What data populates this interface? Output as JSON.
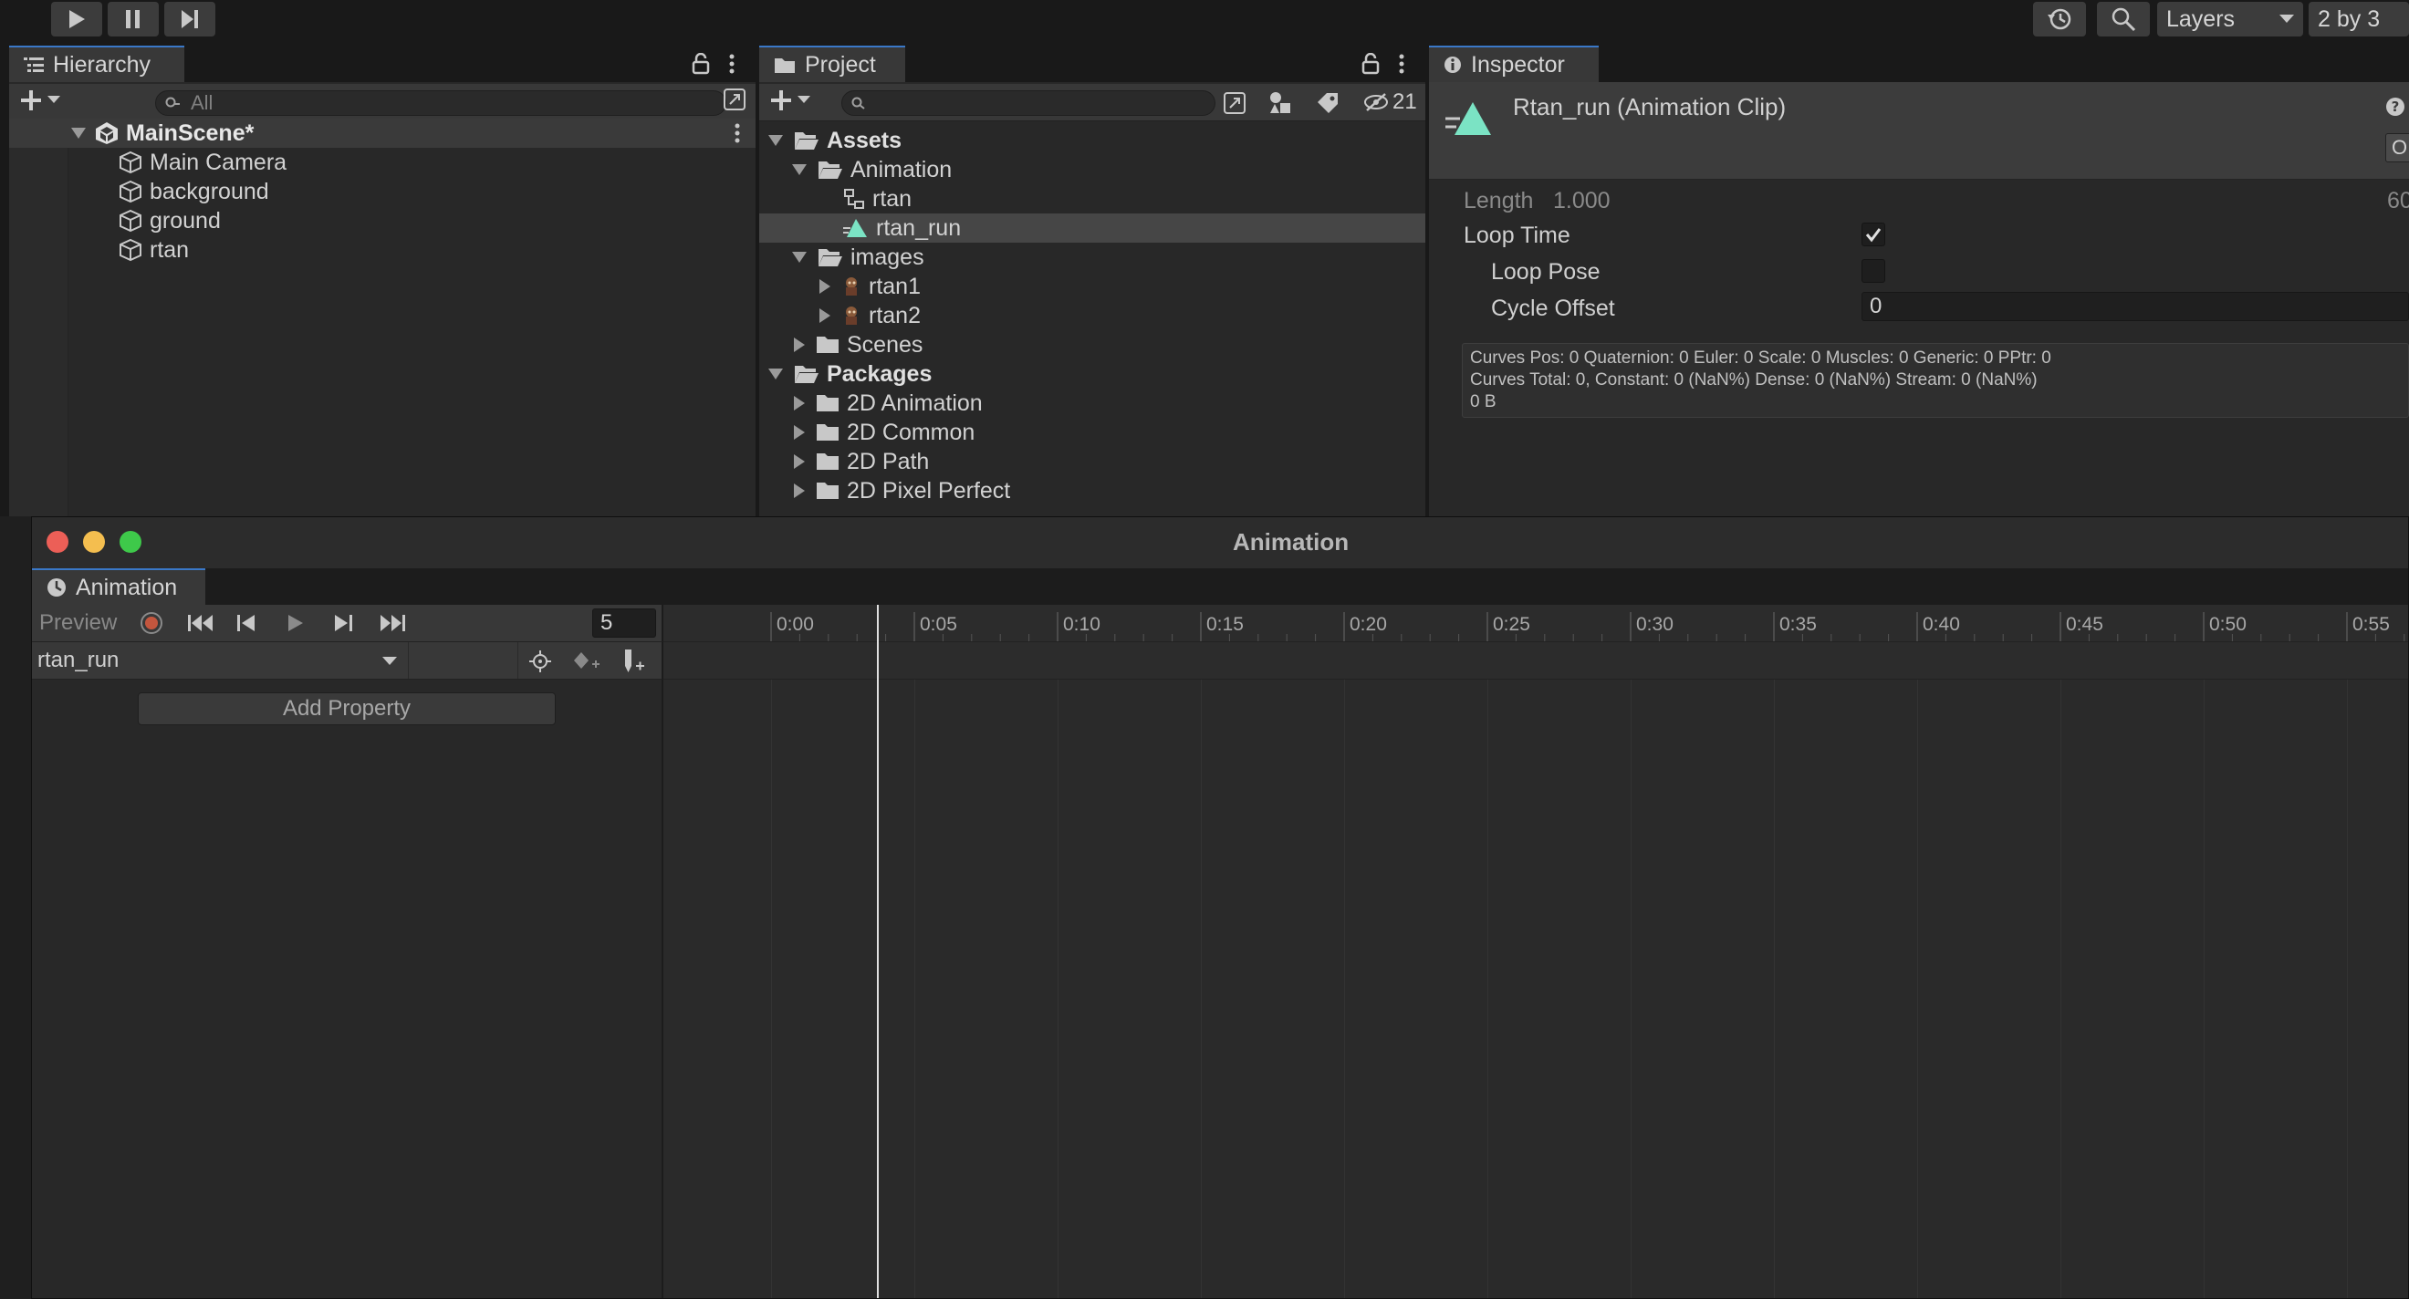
{
  "toolbar": {
    "layers_label": "Layers",
    "layout_label": "2 by 3"
  },
  "hierarchy": {
    "tab_label": "Hierarchy",
    "search_placeholder": "All",
    "scene": "MainScene*",
    "items": [
      "Main Camera",
      "background",
      "ground",
      "rtan"
    ]
  },
  "project": {
    "tab_label": "Project",
    "hidden_count": "21",
    "tree": [
      {
        "label": "Assets",
        "bold": true
      },
      {
        "label": "Animation"
      },
      {
        "label": "rtan"
      },
      {
        "label": "rtan_run"
      },
      {
        "label": "images"
      },
      {
        "label": "rtan1"
      },
      {
        "label": "rtan2"
      },
      {
        "label": "Scenes"
      },
      {
        "label": "Packages",
        "bold": true
      },
      {
        "label": "2D Animation"
      },
      {
        "label": "2D Common"
      },
      {
        "label": "2D Path"
      },
      {
        "label": "2D Pixel Perfect"
      }
    ]
  },
  "inspector": {
    "tab_label": "Inspector",
    "title": "Rtan_run (Animation Clip)",
    "length_label": "Length",
    "length_value": "1.000",
    "length_right": "60",
    "loop_time_label": "Loop Time",
    "loop_time_checked": true,
    "loop_pose_label": "Loop Pose",
    "loop_pose_checked": false,
    "cycle_offset_label": "Cycle Offset",
    "cycle_offset_value": "0",
    "stats_line1": "Curves Pos: 0 Quaternion: 0 Euler: 0 Scale: 0 Muscles: 0 Generic: 0 PPtr: 0",
    "stats_line2": "Curves Total: 0, Constant: 0 (NaN%) Dense: 0 (NaN%) Stream: 0 (NaN%)",
    "stats_line3": "0 B",
    "right_button_label": "O"
  },
  "animation": {
    "window_title": "Animation",
    "tab_label": "Animation",
    "preview_label": "Preview",
    "frame_value": "5",
    "clip_name": "rtan_run",
    "add_property_label": "Add Property",
    "timeline_labels": [
      "0:00",
      "0:05",
      "0:10",
      "0:15",
      "0:20",
      "0:25",
      "0:30",
      "0:35",
      "0:40",
      "0:45",
      "0:50",
      "0:55"
    ],
    "current_frame_label": "0:05"
  },
  "colors": {
    "accent_tab": "#3a78c8",
    "close": "#ec5f57",
    "minimize": "#f4be4f",
    "maximize": "#3ec94a",
    "clip_icon": "#7be3c4"
  }
}
